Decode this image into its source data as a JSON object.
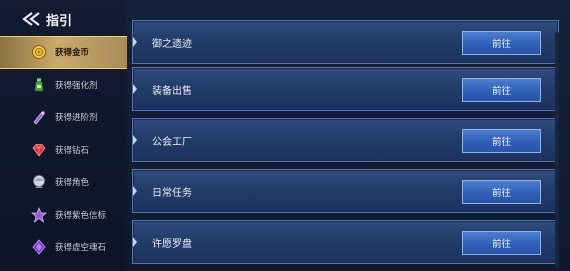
{
  "header": {
    "title": "指引"
  },
  "sidebar": {
    "items": [
      {
        "label": "获得金币",
        "icon": "gold-coin-icon",
        "active": true
      },
      {
        "label": "获得强化剂",
        "icon": "green-bottle-icon",
        "active": false
      },
      {
        "label": "获得进阶剂",
        "icon": "purple-vial-icon",
        "active": false
      },
      {
        "label": "获得钻石",
        "icon": "red-diamond-icon",
        "active": false
      },
      {
        "label": "获得角色",
        "icon": "character-head-icon",
        "active": false
      },
      {
        "label": "获得紫色信标",
        "icon": "purple-beacon-icon",
        "active": false
      },
      {
        "label": "获得虚空魂石",
        "icon": "void-soulstone-icon",
        "active": false
      }
    ]
  },
  "main": {
    "cards": [
      {
        "title": "御之遗迹",
        "button_label": "前往"
      },
      {
        "title": "装备出售",
        "button_label": "前往"
      },
      {
        "title": "公会工厂",
        "button_label": "前往"
      },
      {
        "title": "日常任务",
        "button_label": "前往"
      },
      {
        "title": "许愿罗盘",
        "button_label": "前往"
      }
    ]
  },
  "colors": {
    "accent_gold": "#c9ab6c",
    "button_blue": "#3a68be",
    "card_blue": "#26406e",
    "background": "#0c1426"
  }
}
